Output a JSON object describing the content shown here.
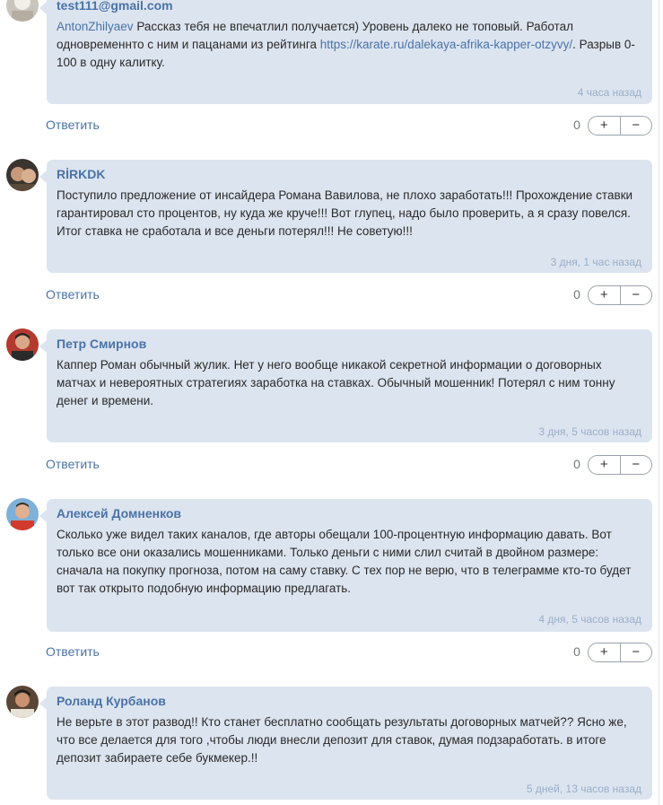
{
  "comments": [
    {
      "author": "test111@gmail.com",
      "mention": "AntonZhilyaev",
      "text_before": " Рассказ тебя не впечатлил получается) Уровень далеко не топовый. Работал одновременнто с ним и пацанами из рейтинга ",
      "link": "https://karate.ru/dalekaya-afrika-kapper-otzyvy/",
      "text_after": ". Разрыв 0-100 в одну калитку.",
      "time": "4 часа назад",
      "reply": "Ответить",
      "score": "0",
      "plus": "+",
      "minus": "−"
    },
    {
      "author": "RİRKDK",
      "text": "Поступило предложение от инсайдера Романа Вавилова, не плохо заработать!!! Прохождение ставки гарантировал сто процентов, ну куда же круче!!! Вот глупец, надо было проверить, а я сразу повелся. Итог ставка не сработала и все деньги потерял!!! Не советую!!!",
      "time": "3 дня, 1 час назад",
      "reply": "Ответить",
      "score": "0",
      "plus": "+",
      "minus": "−"
    },
    {
      "author": "Петр Смирнов",
      "text": "Каппер Роман обычный жулик. Нет у него вообще никакой секретной информации о договорных матчах и невероятных стратегиях заработка на ставках. Обычный мошенник! Потерял с ним тонну денег и времени.",
      "time": "3 дня, 5 часов назад",
      "reply": "Ответить",
      "score": "0",
      "plus": "+",
      "minus": "−"
    },
    {
      "author": "Алексей Домненков",
      "text": "Сколько уже видел таких каналов, где авторы обещали 100-процентную информацию давать. Вот только все они оказались мошенниками. Только деньги с ними слил считай в двойном размере: сначала на покупку прогноза, потом на саму ставку. С тех пор не верю, что в телеграмме кто-то будет вот так открыто подобную информацию предлагать.",
      "time": "4 дня, 5 часов назад",
      "reply": "Ответить",
      "score": "0",
      "plus": "+",
      "minus": "−"
    },
    {
      "author": "Роланд Курбанов",
      "text": "Не верьте в этот развод!! Кто станет бесплатно сообщать результаты договорных матчей?? Ясно же, что все делается для того ,чтобы люди внесли депозит для ставок, думая подзаработать. в итоге депозит забираете себе букмекер.!!",
      "time": "5 дней, 13 часов назад"
    }
  ],
  "colors": {
    "bubble": "#dce4ef",
    "author": "#4a73a8",
    "time": "#9aaec9"
  }
}
